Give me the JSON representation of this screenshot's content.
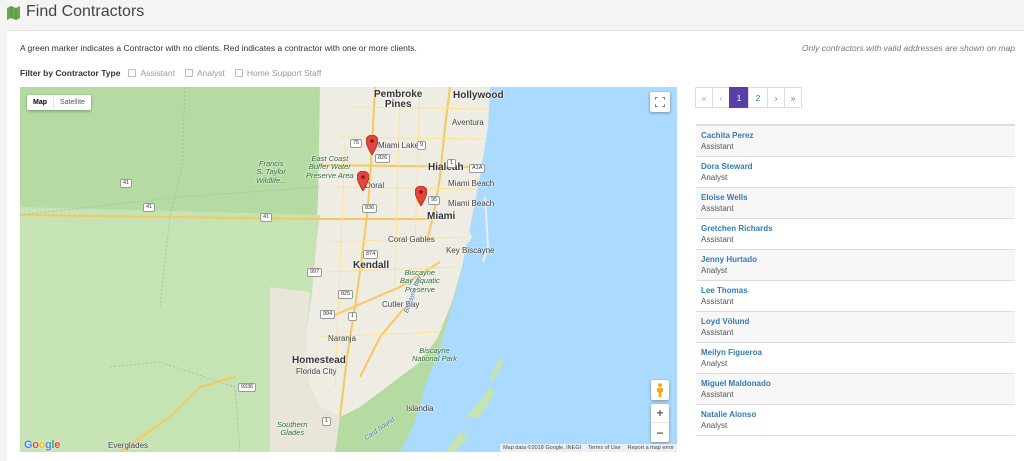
{
  "page": {
    "title": "Find Contractors",
    "info": "A green marker indicates a Contractor with no clients. Red indicates a contractor with one or more clients.",
    "note": "Only contractors with valid addresses are shown on map"
  },
  "filter": {
    "label": "Filter by Contractor Type",
    "options": [
      {
        "label": "Assistant",
        "checked": false
      },
      {
        "label": "Analyst",
        "checked": false
      },
      {
        "label": "Home Support Staff",
        "checked": false
      }
    ]
  },
  "map": {
    "type_buttons": [
      "Map",
      "Satellite"
    ],
    "active_type": "Map",
    "zoom_in": "+",
    "zoom_out": "−",
    "logo": "Google",
    "attribution": [
      "Map data ©2018 Google, INEGI",
      "Terms of Use",
      "Report a map error"
    ],
    "places": {
      "pembroke_pines": "Pembroke\nPines",
      "hollywood": "Hollywood",
      "aventura": "Aventura",
      "miami_lakes": "Miami Lakes",
      "hialeah": "Hialeah",
      "doral": "Doral",
      "miami_beach_1": "Miami Beach",
      "miami_beach_2": "Miami Beach",
      "miami": "Miami",
      "coral_gables": "Coral Gables",
      "key_biscayne": "Key Biscayne",
      "kendall": "Kendall",
      "cutler_bay": "Cutler Bay",
      "naranja": "Naranja",
      "homestead": "Homestead",
      "florida_city": "Florida City",
      "islandia": "Islandia",
      "everglades": "Everglades",
      "francis_taylor": "Francis\nS. Taylor\nWildlife...",
      "east_coast_buffer": "East Coast\nBuffer Water\nPreserve Area",
      "biscayne_aquatic": "Biscayne\nBay Aquatic\nPreserve",
      "biscayne_np": "Biscayne\nNational Park",
      "southern_glades": "Southern\nGlades",
      "biscayne_bay": "Biscayne Bay",
      "card_sound": "Card Sound"
    },
    "shields": [
      "826",
      "9",
      "75",
      "1",
      "A1A",
      "836",
      "95",
      "41",
      "41",
      "41",
      "874",
      "997",
      "825",
      "994",
      "1",
      "9336",
      "1"
    ],
    "markers": [
      {
        "color": "#e5453c",
        "status": "one or more clients"
      },
      {
        "color": "#e5453c",
        "status": "one or more clients"
      },
      {
        "color": "#e5453c",
        "status": "one or more clients"
      }
    ]
  },
  "pager": {
    "first": "«",
    "prev": "‹",
    "pages": [
      "1",
      "2"
    ],
    "current": "1",
    "next": "›",
    "last": "»"
  },
  "contractors": [
    {
      "name": "Cachita Perez",
      "type": "Assistant"
    },
    {
      "name": "Dora Steward",
      "type": "Analyst"
    },
    {
      "name": "Eloise Wells",
      "type": "Assistant"
    },
    {
      "name": "Gretchen Richards",
      "type": "Assistant"
    },
    {
      "name": "Jenny Hurtado",
      "type": "Analyst"
    },
    {
      "name": "Lee Thomas",
      "type": "Assistant"
    },
    {
      "name": "Loyd Völund",
      "type": "Assistant"
    },
    {
      "name": "Meilyn Figueroa",
      "type": "Analyst"
    },
    {
      "name": "Miguel Maldonado",
      "type": "Assistant"
    },
    {
      "name": "Natalie Alonso",
      "type": "Analyst"
    }
  ],
  "colors": {
    "accent": "#5a3fa8",
    "link": "#337ab7",
    "header_icon": "#6aa84f",
    "marker_red": "#e5453c",
    "water": "#aadaff",
    "land_green": "#b6dba2",
    "land_urban": "#efece4"
  }
}
